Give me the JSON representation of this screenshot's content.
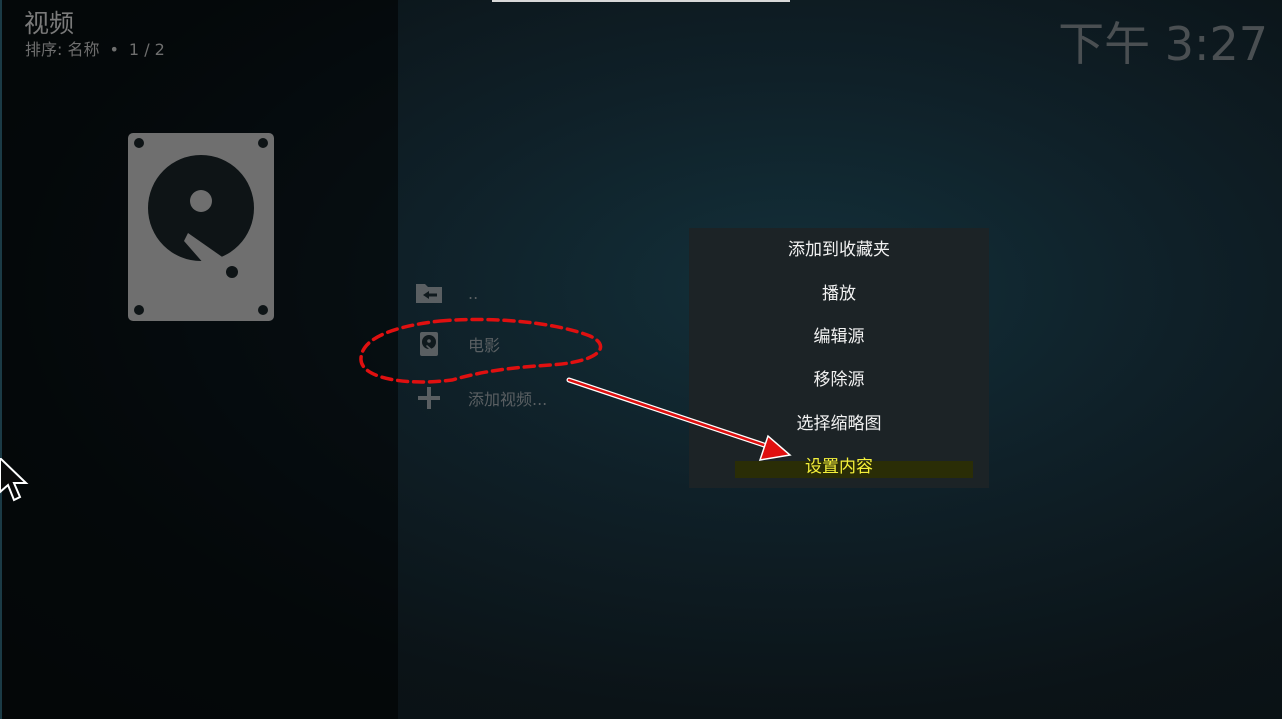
{
  "header": {
    "title": "视频",
    "sort_label": "排序: 名称",
    "separator": "•",
    "page": "1 / 2",
    "clock": "下午 3:27"
  },
  "sources_list": [
    {
      "label": "..",
      "icon": "folder-back-icon"
    },
    {
      "label": "电影",
      "icon": "hard-drive-icon"
    },
    {
      "label": "添加视频...",
      "icon": "plus-icon"
    }
  ],
  "context_menu": {
    "items": [
      {
        "label": "添加到收藏夹"
      },
      {
        "label": "播放"
      },
      {
        "label": "编辑源"
      },
      {
        "label": "移除源"
      },
      {
        "label": "选择缩略图"
      },
      {
        "label": "设置内容"
      }
    ],
    "focused_index": 5
  },
  "colors": {
    "focused_text": "#f4f03a",
    "annotation_red": "#e01010",
    "menu_bg": "#1c2326"
  }
}
